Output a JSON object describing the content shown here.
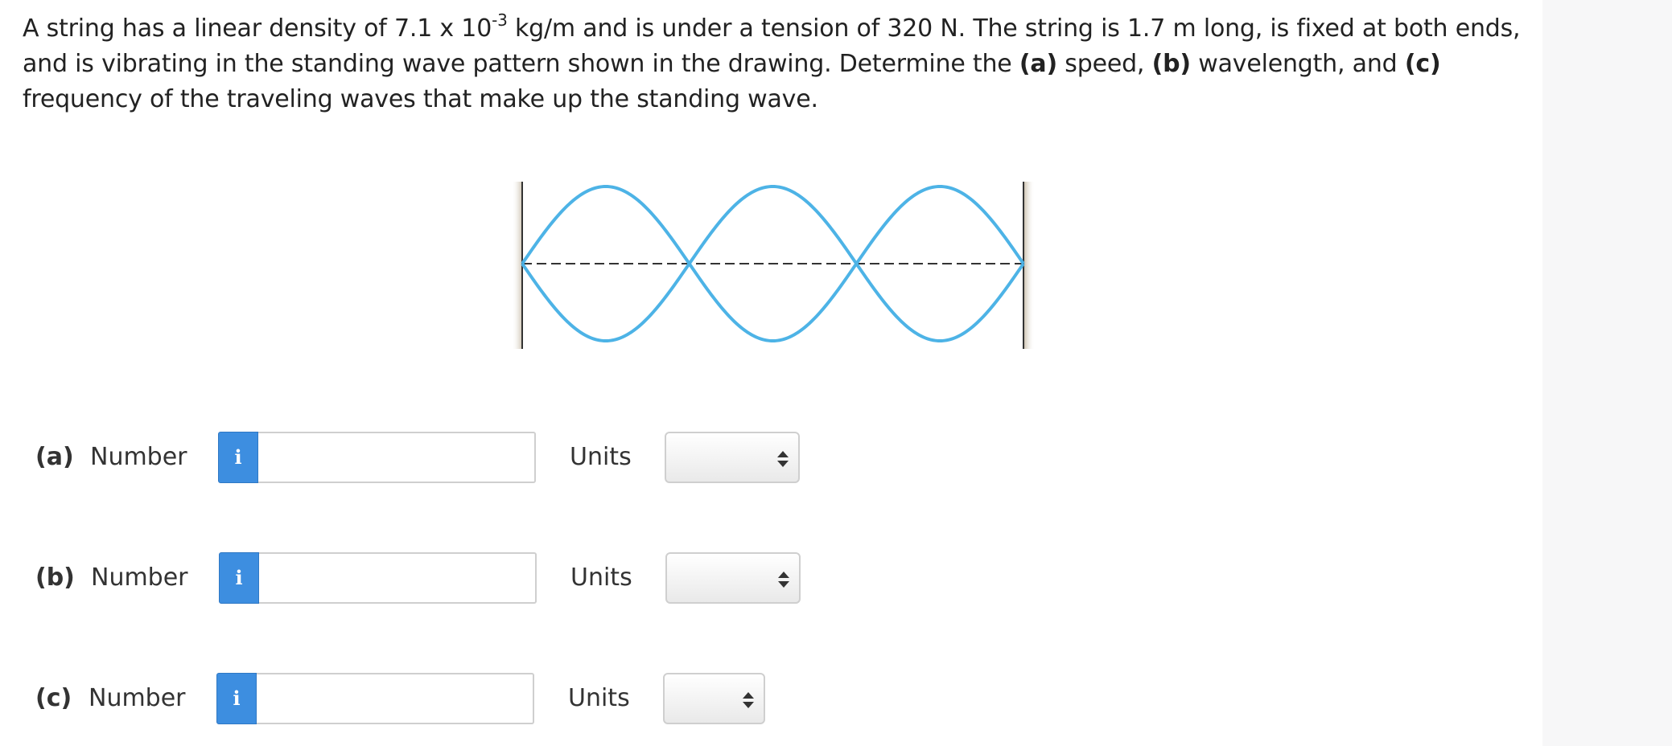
{
  "question": {
    "line1_before_exp": "A string has a linear density of 7.1 x 10",
    "exponent": "-3",
    "line1_after_exp": " kg/m and is under a tension of 320 N. The string is 1.7 m long, is fixed at both ends, and is vibrating in the standing wave pattern shown in the drawing. Determine the ",
    "part_a_tag": "(a)",
    "part_a_text": " speed, ",
    "part_b_tag": "(b)",
    "part_b_text": " wavelength, and ",
    "part_c_tag": "(c)",
    "part_c_text": " frequency of the traveling waves that make up the standing wave."
  },
  "figure": {
    "wave_color": "#4db3e6",
    "wall_color": "#c8bda8",
    "loops": 3
  },
  "answers": [
    {
      "part": "(a)",
      "number_label": "Number",
      "info_icon": "i",
      "value": "",
      "units_label": "Units",
      "units_selected": ""
    },
    {
      "part": "(b)",
      "number_label": "Number",
      "info_icon": "i",
      "value": "",
      "units_label": "Units",
      "units_selected": ""
    },
    {
      "part": "(c)",
      "number_label": "Number",
      "info_icon": "i",
      "value": "",
      "units_label": "Units",
      "units_selected": ""
    }
  ]
}
